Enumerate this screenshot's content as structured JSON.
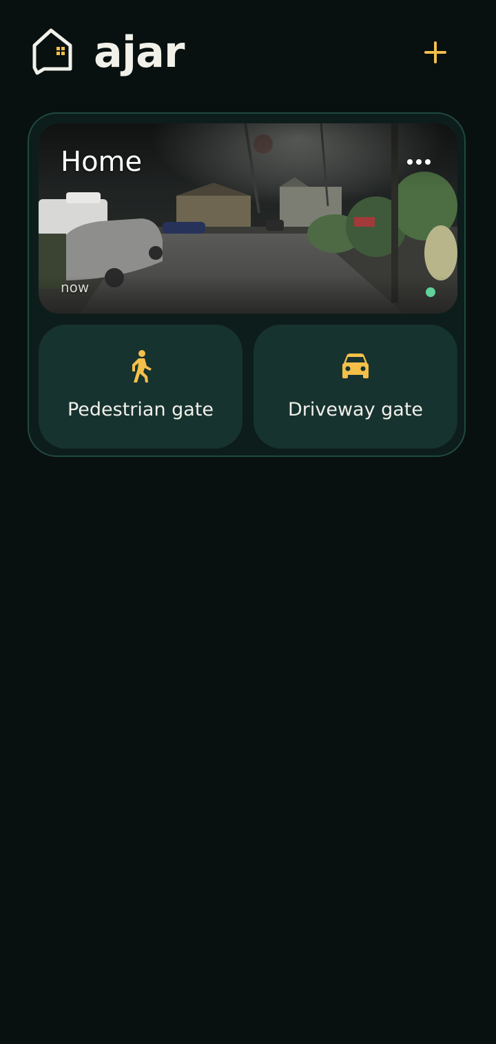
{
  "app": {
    "brand": "ajar",
    "accent_color": "#f4c04a",
    "background_color": "#081110"
  },
  "header": {
    "logo_icon": "home-icon",
    "add_icon": "plus-icon"
  },
  "location_card": {
    "title": "Home",
    "more_icon": "more-horizontal-icon",
    "camera": {
      "timestamp": "now",
      "status": "live",
      "status_color": "#5fd39a"
    },
    "gates": [
      {
        "label": "Pedestrian gate",
        "icon": "walking-person-icon"
      },
      {
        "label": "Driveway gate",
        "icon": "car-icon"
      }
    ]
  }
}
